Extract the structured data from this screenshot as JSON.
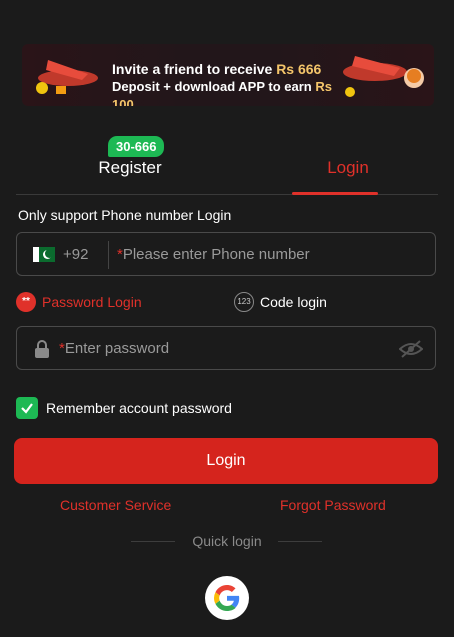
{
  "banner": {
    "line1": "Invite a friend to receive",
    "line1_amount": "Rs 666",
    "line2": "Deposit + download APP to earn",
    "line2_amount": "Rs 100"
  },
  "tabs": {
    "register": "Register",
    "register_badge": "30-666",
    "login": "Login",
    "active": "login"
  },
  "note": "Only support Phone number Login",
  "phone": {
    "country_code": "+92",
    "required_mark": "*",
    "placeholder": "Please enter Phone number"
  },
  "login_modes": {
    "password_icon": "**",
    "password_label": "Password Login",
    "code_icon": "123",
    "code_label": "Code login"
  },
  "password": {
    "required_mark": "*",
    "placeholder": "Enter password"
  },
  "remember": {
    "label": "Remember account password",
    "checked": true
  },
  "login_button": "Login",
  "links": {
    "customer_service": "Customer Service",
    "forgot_password": "Forgot Password"
  },
  "quick_login": "Quick login",
  "colors": {
    "accent": "#e0312a",
    "success": "#1db954",
    "background": "#1b1b1b"
  }
}
